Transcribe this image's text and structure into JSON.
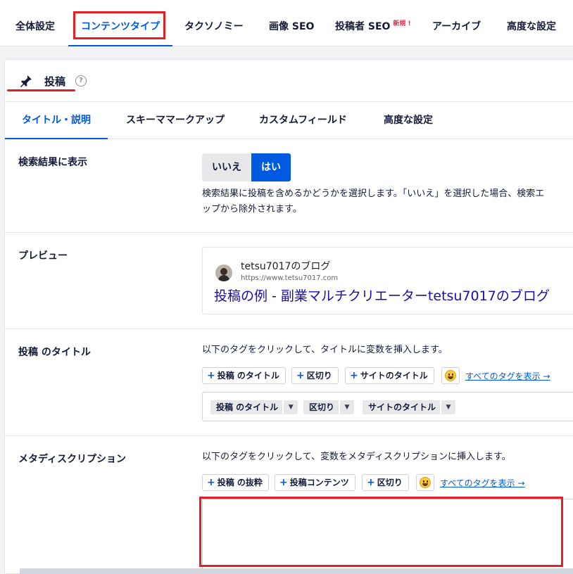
{
  "top_tabs": [
    "全体設定",
    "コンテンツタイプ",
    "タクソノミー",
    "画像 SEO",
    "投稿者 SEO",
    "アーカイブ",
    "高度な設定"
  ],
  "top_tab_new_badge": "新規 !",
  "card": {
    "icon": "pin-icon",
    "title": "投稿",
    "help": "?"
  },
  "sub_tabs": [
    "タイトル・説明",
    "スキーママークアップ",
    "カスタムフィールド",
    "高度な設定"
  ],
  "search_results": {
    "label": "検索結果に表示",
    "no_label": "いいえ",
    "yes_label": "はい",
    "desc_line1": "検索結果に投稿を含めるかどうかを選択します。「いいえ」を選択した場合、検索エ",
    "desc_line2": "ップから除外されます。"
  },
  "preview": {
    "label": "プレビュー",
    "site_name": "tetsu7017のブログ",
    "site_url": "https://www.tetsu7017.com",
    "title": "投稿の例 - 副業マルチクリエーターtetsu7017のブログ"
  },
  "post_title": {
    "label": "投稿 のタイトル",
    "desc": "以下のタグをクリックして、タイトルに変数を挿入します。",
    "tags": [
      "投稿 のタイトル",
      "区切り",
      "サイトのタイトル"
    ],
    "show_all": "すべてのタグを表示 →",
    "chips": [
      "投稿 のタイトル",
      "区切り",
      "サイトのタイトル"
    ]
  },
  "meta_desc": {
    "label": "メタディスクリプション",
    "desc": "以下のタグをクリックして、変数をメタディスクリプションに挿入します。",
    "tags": [
      "投稿 の抜粋",
      "投稿コンテンツ",
      "区切り"
    ],
    "show_all": "すべてのタグを表示 →"
  },
  "colors": {
    "accent": "#005ae0",
    "annotation": "#e41f26",
    "preview_title": "#1a0dab"
  }
}
